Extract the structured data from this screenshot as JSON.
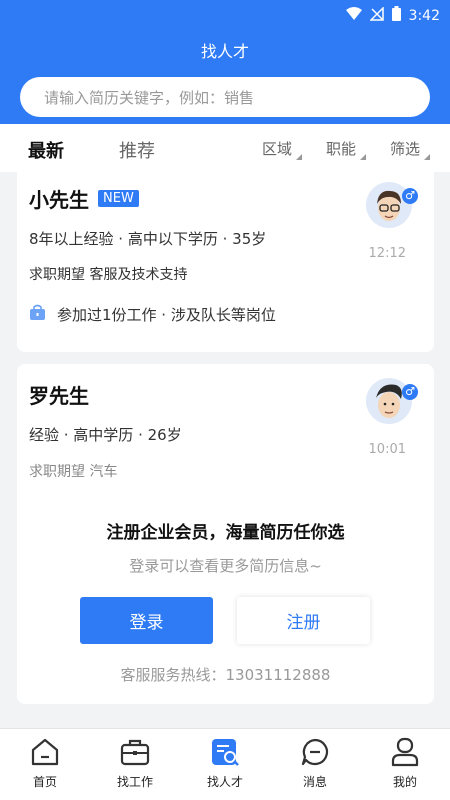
{
  "status": {
    "time": "3:42"
  },
  "header": {
    "title": "找人才",
    "search_placeholder": "请输入简历关键字，例如：销售"
  },
  "filters": {
    "tab_latest": "最新",
    "tab_recommend": "推荐",
    "region": "区域",
    "position": "职能",
    "filter": "筛选"
  },
  "cards": [
    {
      "name": "小先生",
      "badge": "NEW",
      "info": "8年以上经验 · 高中以下学历 · 35岁",
      "expect": "求职期望 客服及技术支持",
      "history": "参加过1份工作 · 涉及队长等岗位",
      "time": "12:12",
      "gender": "♂"
    },
    {
      "name": "罗先生",
      "info": "经验 · 高中学历 · 26岁",
      "expect": "求职期望 汽车",
      "time": "10:01",
      "gender": "♂"
    }
  ],
  "overlay": {
    "title": "注册企业会员，海量简历任你选",
    "subtitle": "登录可以查看更多简历信息~",
    "login": "登录",
    "register": "注册",
    "hotline": "客服服务热线：13031112888"
  },
  "tabbar": [
    {
      "label": "首页",
      "icon": "home-icon"
    },
    {
      "label": "找工作",
      "icon": "briefcase-icon"
    },
    {
      "label": "找人才",
      "icon": "resume-search-icon"
    },
    {
      "label": "消息",
      "icon": "message-icon"
    },
    {
      "label": "我的",
      "icon": "user-icon"
    }
  ],
  "colors": {
    "primary": "#2f7bf5"
  }
}
